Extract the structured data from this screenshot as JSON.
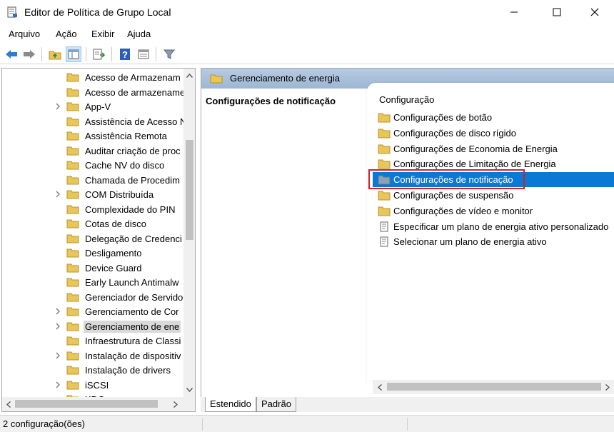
{
  "window": {
    "title": "Editor de Política de Grupo Local",
    "controls": [
      "minimize-icon",
      "maximize-icon",
      "close-icon"
    ]
  },
  "menu": [
    "Arquivo",
    "Ação",
    "Exibir",
    "Ajuda"
  ],
  "toolbar": {
    "buttons": [
      "back-arrow-icon",
      "forward-arrow-icon",
      "up-folder-icon",
      "show-hide-tree-icon",
      "export-list-icon",
      "help-icon",
      "properties-icon",
      "filter-icon"
    ]
  },
  "tree": {
    "items": [
      {
        "label": "Acesso de Armazenam",
        "expandable": false
      },
      {
        "label": "Acesso de armazename",
        "expandable": false
      },
      {
        "label": "App-V",
        "expandable": true
      },
      {
        "label": "Assistência de Acesso N",
        "expandable": false
      },
      {
        "label": "Assistência Remota",
        "expandable": false
      },
      {
        "label": "Auditar criação de proc",
        "expandable": false
      },
      {
        "label": "Cache NV do disco",
        "expandable": false
      },
      {
        "label": "Chamada de Procedim",
        "expandable": false
      },
      {
        "label": "COM Distribuída",
        "expandable": true
      },
      {
        "label": "Complexidade do PIN",
        "expandable": false
      },
      {
        "label": "Cotas de disco",
        "expandable": false
      },
      {
        "label": "Delegação de Credenci",
        "expandable": false
      },
      {
        "label": "Desligamento",
        "expandable": false
      },
      {
        "label": "Device Guard",
        "expandable": false
      },
      {
        "label": "Early Launch Antimalw",
        "expandable": false
      },
      {
        "label": "Gerenciador de Servido",
        "expandable": false
      },
      {
        "label": "Gerenciamento de Cor",
        "expandable": true
      },
      {
        "label": "Gerenciamento de ene",
        "expandable": true,
        "selected": true
      },
      {
        "label": "Infraestrutura de Classi",
        "expandable": false
      },
      {
        "label": "Instalação de dispositiv",
        "expandable": true
      },
      {
        "label": "Instalação de drivers",
        "expandable": false
      },
      {
        "label": "iSCSI",
        "expandable": true
      },
      {
        "label": "KDC",
        "expandable": false
      }
    ]
  },
  "right": {
    "header": "Gerenciamento de energia",
    "description_title": "Configurações de notificação",
    "column_header": "Configuração",
    "items": [
      {
        "label": "Configurações de botão",
        "type": "folder"
      },
      {
        "label": "Configurações de disco rígido",
        "type": "folder"
      },
      {
        "label": "Configurações de Economia de Energia",
        "type": "folder"
      },
      {
        "label": "Configurações de Limitação de Energia",
        "type": "folder"
      },
      {
        "label": "Configurações de notificação",
        "type": "folder",
        "selected": true
      },
      {
        "label": "Configurações de suspensão",
        "type": "folder"
      },
      {
        "label": "Configurações de vídeo e monitor",
        "type": "folder"
      },
      {
        "label": "Especificar um plano de energia ativo personalizado",
        "type": "setting"
      },
      {
        "label": "Selecionar um plano de energia ativo",
        "type": "setting"
      }
    ]
  },
  "tabs": [
    {
      "label": "Estendido",
      "active": true
    },
    {
      "label": "Padrão",
      "active": false
    }
  ],
  "status": "2 configuração(ões)",
  "colors": {
    "selection": "#0a79d6",
    "highlight_box": "#d0202a",
    "header_gradient": "#9db6d3",
    "folder": "#e8c65a"
  }
}
